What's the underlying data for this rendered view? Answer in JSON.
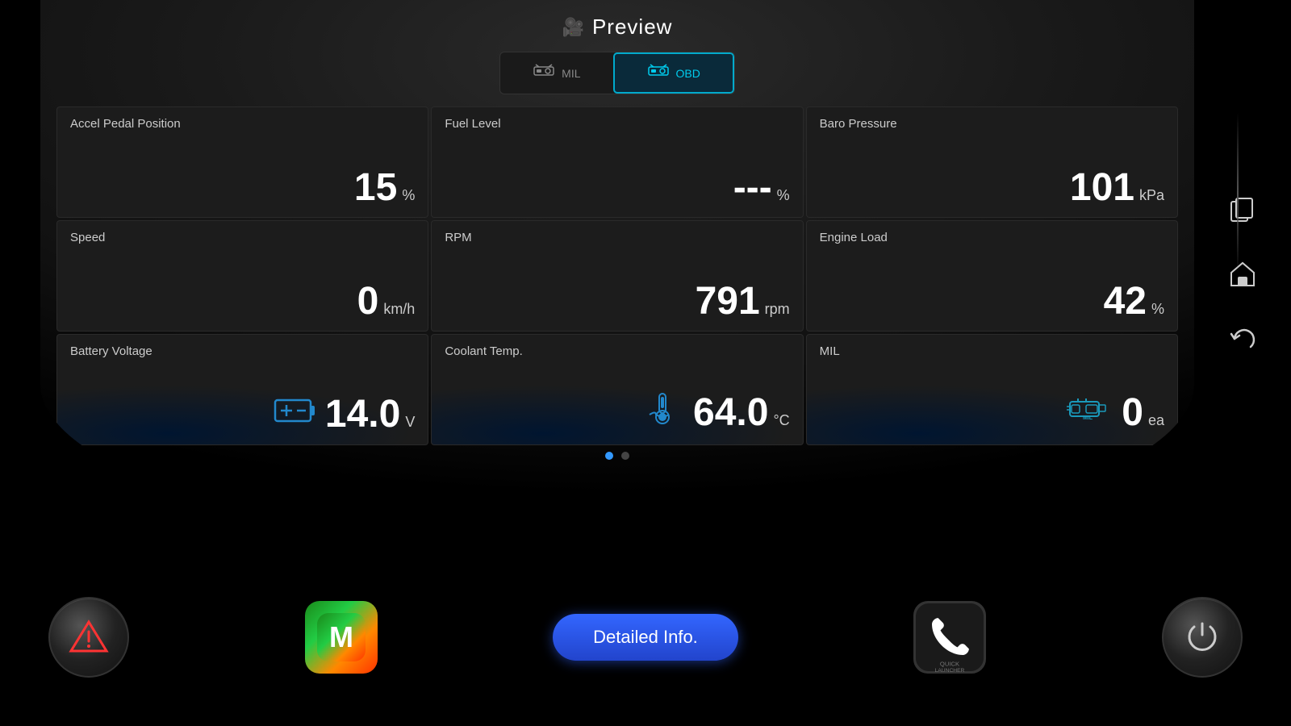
{
  "header": {
    "title": "Preview",
    "camera_icon": "🎥"
  },
  "tabs": [
    {
      "id": "mil",
      "label": "MIL",
      "active": false
    },
    {
      "id": "obd",
      "label": "OBD",
      "active": true
    }
  ],
  "cards": [
    {
      "id": "accel-pedal",
      "label": "Accel Pedal Position",
      "value": "15",
      "unit": "%",
      "highlight": false,
      "icon": null
    },
    {
      "id": "fuel-level",
      "label": "Fuel Level",
      "value": "---",
      "unit": "%",
      "highlight": false,
      "icon": null
    },
    {
      "id": "baro-pressure",
      "label": "Baro Pressure",
      "value": "101",
      "unit": "kPa",
      "highlight": false,
      "icon": null
    },
    {
      "id": "speed",
      "label": "Speed",
      "value": "0",
      "unit": "km/h",
      "highlight": false,
      "icon": null
    },
    {
      "id": "rpm",
      "label": "RPM",
      "value": "791",
      "unit": "rpm",
      "highlight": false,
      "icon": null
    },
    {
      "id": "engine-load",
      "label": "Engine Load",
      "value": "42",
      "unit": "%",
      "highlight": false,
      "icon": null
    },
    {
      "id": "battery-voltage",
      "label": "Battery Voltage",
      "value": "14.0",
      "unit": "V",
      "highlight": true,
      "icon": "battery"
    },
    {
      "id": "coolant-temp",
      "label": "Coolant Temp.",
      "value": "64.0",
      "unit": "°C",
      "highlight": true,
      "icon": "thermometer"
    },
    {
      "id": "mil",
      "label": "MIL",
      "value": "0",
      "unit": "ea",
      "highlight": true,
      "icon": "engine"
    }
  ],
  "pagination": {
    "dots": [
      {
        "active": true
      },
      {
        "active": false
      }
    ]
  },
  "taskbar": {
    "alert_btn": "⚠",
    "maps_btn": "M",
    "detailed_btn": "Detailed Info.",
    "phone_btn": "📞",
    "power_btn": "⏻"
  },
  "sidebar": {
    "copy_icon": "⧉",
    "home_icon": "⌂",
    "back_icon": "↩"
  }
}
